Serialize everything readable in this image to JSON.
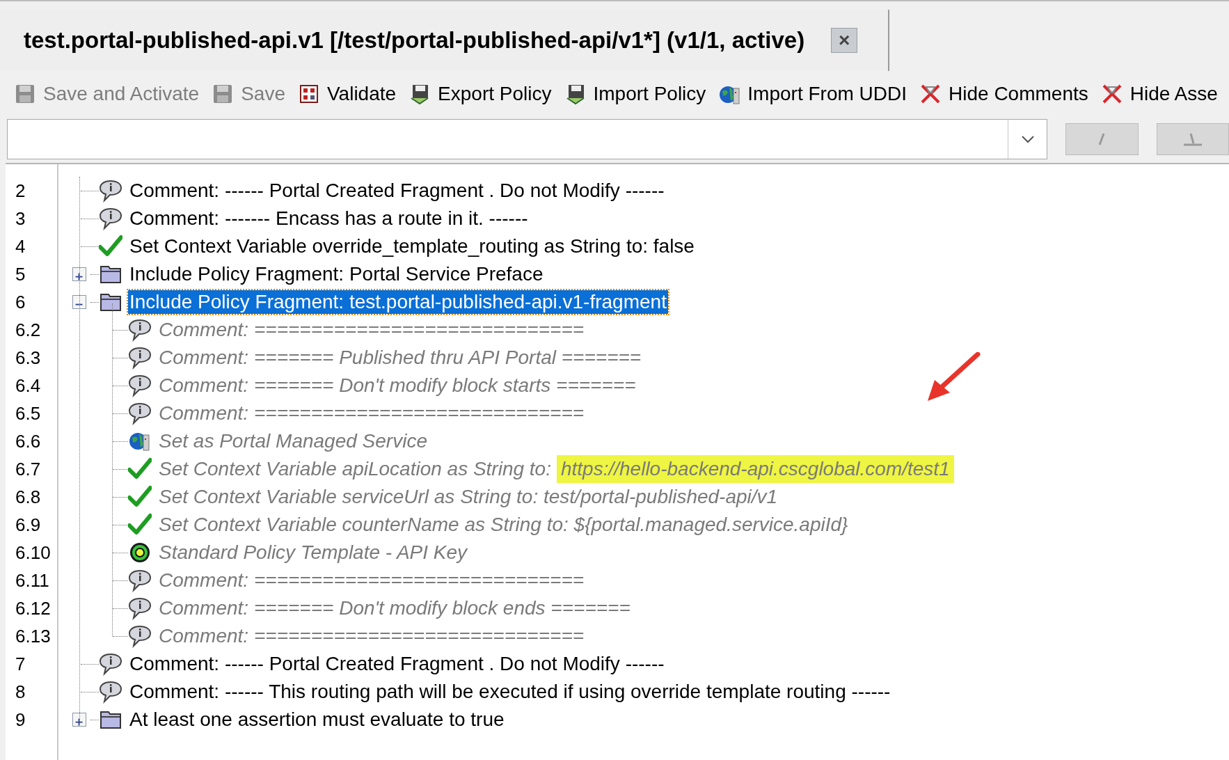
{
  "tab": {
    "title": "test.portal-published-api.v1 [/test/portal-published-api/v1*] (v1/1, active)",
    "close": "×"
  },
  "toolbar": [
    {
      "kind": "save",
      "label": "Save and Activate",
      "disabled": true
    },
    {
      "kind": "save",
      "label": "Save",
      "disabled": true
    },
    {
      "kind": "validate",
      "label": "Validate",
      "disabled": false
    },
    {
      "kind": "disk",
      "label": "Export Policy",
      "disabled": false
    },
    {
      "kind": "disk",
      "label": "Import Policy",
      "disabled": false
    },
    {
      "kind": "globe",
      "label": "Import From UDDI",
      "disabled": false
    },
    {
      "kind": "hide",
      "label": "Hide Comments",
      "disabled": false
    },
    {
      "kind": "hide",
      "label": "Hide Asse",
      "disabled": false
    }
  ],
  "tree": [
    {
      "line": "2",
      "kind": "comment",
      "text": "Comment: ------ Portal Created Fragment . Do not Modify ------",
      "selected": false
    },
    {
      "line": "3",
      "kind": "comment",
      "text": "Comment: ------- Encass has a route in it. ------",
      "selected": false
    },
    {
      "line": "4",
      "kind": "check",
      "text": "Set Context Variable override_template_routing as String to: false",
      "selected": false
    },
    {
      "line": "5",
      "kind": "folder",
      "text": "Include Policy Fragment: Portal Service Preface",
      "selected": false,
      "expanded": false
    },
    {
      "line": "6",
      "kind": "folder",
      "text": "Include Policy Fragment: test.portal-published-api.v1-fragment",
      "selected": true,
      "expanded": true,
      "children": [
        {
          "line": "6.2",
          "kind": "comment",
          "text": "Comment: =============================",
          "selected": false
        },
        {
          "line": "6.3",
          "kind": "comment",
          "text": "Comment: ======= Published thru API Portal =======",
          "selected": false
        },
        {
          "line": "6.4",
          "kind": "comment",
          "text": "Comment: ======= Don't modify block starts =======",
          "selected": false
        },
        {
          "line": "6.5",
          "kind": "comment",
          "text": "Comment: =============================",
          "selected": false
        },
        {
          "line": "6.6",
          "kind": "globe",
          "text": "Set as Portal Managed Service",
          "selected": false
        },
        {
          "line": "6.7",
          "kind": "check",
          "text": "Set Context Variable apiLocation as String to:",
          "highlight": "https://hello-backend-api.cscglobal.com/test1",
          "selected": false
        },
        {
          "line": "6.8",
          "kind": "check",
          "text": "Set Context Variable serviceUrl as String to: test/portal-published-api/v1",
          "selected": false
        },
        {
          "line": "6.9",
          "kind": "check",
          "text": "Set Context Variable counterName as String to: ${portal.managed.service.apiId}",
          "selected": false
        },
        {
          "line": "6.10",
          "kind": "gear",
          "text": "Standard Policy Template - API Key",
          "selected": false
        },
        {
          "line": "6.11",
          "kind": "comment",
          "text": "Comment: =============================",
          "selected": false
        },
        {
          "line": "6.12",
          "kind": "comment",
          "text": "Comment: ======= Don't modify block ends =======",
          "selected": false
        },
        {
          "line": "6.13",
          "kind": "comment",
          "text": "Comment: =============================",
          "selected": false
        }
      ]
    },
    {
      "line": "7",
      "kind": "comment",
      "text": "Comment: ------ Portal Created Fragment . Do not Modify ------",
      "selected": false
    },
    {
      "line": "8",
      "kind": "comment",
      "text": "Comment: ------ This routing path will be executed if using override template routing ------",
      "selected": false
    },
    {
      "line": "9",
      "kind": "folder",
      "text": "At least one assertion must evaluate to true",
      "selected": false,
      "expanded": false
    }
  ]
}
